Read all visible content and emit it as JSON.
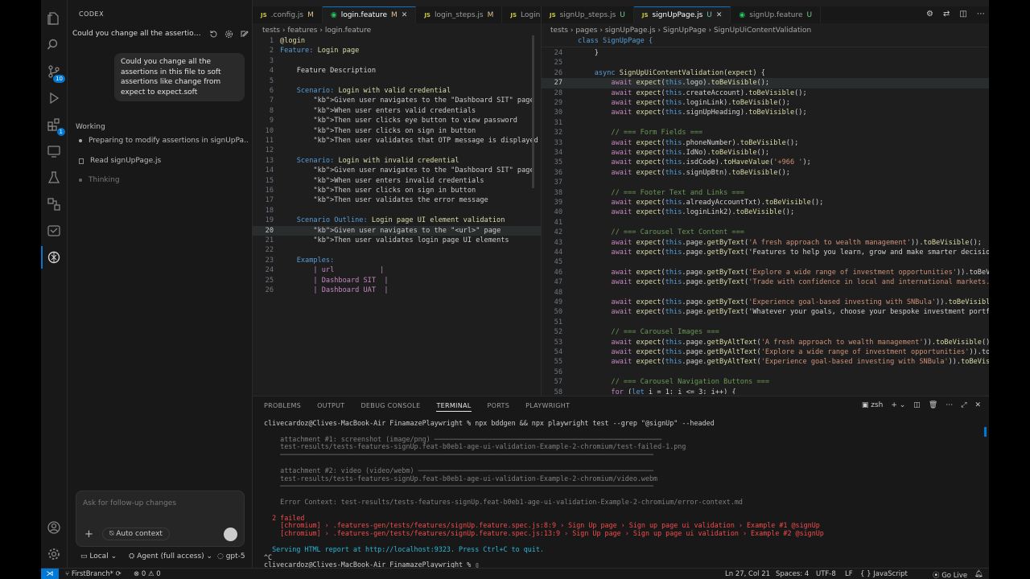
{
  "activity": {
    "scm_badge": "10",
    "test_badge": "1"
  },
  "codex": {
    "title": "CODEX",
    "thread_title": "Could you change all the assertions in t...",
    "user_message": "Could you change all the assertions in this file to soft assertions like change from expect to expect.soft",
    "working_label": "Working",
    "steps": [
      {
        "label": "Preparing to modify assertions in signUpPa..."
      },
      {
        "label": "Read signUpPage.js"
      },
      {
        "label": "Thinking"
      }
    ],
    "input_placeholder": "Ask for follow-up changes",
    "auto_context": "Auto context",
    "footer": {
      "local": "Local",
      "agent": "Agent (full access)",
      "model": "gpt-5"
    }
  },
  "left_tabs": [
    {
      "label": ".config.js",
      "status": "M",
      "icon": "js"
    },
    {
      "label": "login.feature",
      "status": "M",
      "icon": "feature",
      "active": true
    },
    {
      "label": "login_steps.js",
      "status": "M",
      "icon": "js"
    },
    {
      "label": "LoginP",
      "status": "",
      "icon": "js"
    }
  ],
  "right_tabs": [
    {
      "label": "signUp_steps.js",
      "status": "U",
      "icon": "js"
    },
    {
      "label": "signUpPage.js",
      "status": "U",
      "icon": "js",
      "active": true
    },
    {
      "label": "signUp.feature",
      "status": "U",
      "icon": "feature"
    }
  ],
  "left_breadcrumb": [
    "tests",
    "features",
    "login.feature"
  ],
  "right_breadcrumb": [
    "tests",
    "pages",
    "signUpPage.js",
    "SignUpPage",
    "SignUpUiContentValidation"
  ],
  "feature_lines": [
    {
      "n": "1",
      "t": "@login",
      "cls": "y"
    },
    {
      "n": "2",
      "t": "Feature: Login page",
      "cls": "mix1"
    },
    {
      "n": "3",
      "t": ""
    },
    {
      "n": "4",
      "t": "    Feature Description",
      "cls": "p"
    },
    {
      "n": "5",
      "t": ""
    },
    {
      "n": "6",
      "t": "    Scenario: Login with valid credential",
      "cls": "scn"
    },
    {
      "n": "7",
      "t": "        Given user navigates to the \"Dashboard SIT\" page",
      "cls": "step"
    },
    {
      "n": "8",
      "t": "        When user enters valid credentials",
      "cls": "step"
    },
    {
      "n": "9",
      "t": "        Then user clicks eye button to view password",
      "cls": "step"
    },
    {
      "n": "10",
      "t": "        Then user clicks on sign in button",
      "cls": "step"
    },
    {
      "n": "11",
      "t": "        Then user validates that OTP message is displayed",
      "cls": "step"
    },
    {
      "n": "12",
      "t": ""
    },
    {
      "n": "13",
      "t": "    Scenario: Login with invalid credential",
      "cls": "scn"
    },
    {
      "n": "14",
      "t": "        Given user navigates to the \"Dashboard SIT\" page",
      "cls": "step"
    },
    {
      "n": "15",
      "t": "        When user enters invalid credentials",
      "cls": "step"
    },
    {
      "n": "16",
      "t": "        Then user clicks on sign in button",
      "cls": "step"
    },
    {
      "n": "17",
      "t": "        Then user validates the error message",
      "cls": "step"
    },
    {
      "n": "18",
      "t": ""
    },
    {
      "n": "19",
      "t": "    Scenario Outline: Login page UI element validation",
      "cls": "scn"
    },
    {
      "n": "20",
      "t": "        Given user navigates to the \"<url>\" page",
      "cls": "step"
    },
    {
      "n": "21",
      "t": "        Then user validates login page UI elements",
      "cls": "step"
    },
    {
      "n": "22",
      "t": ""
    },
    {
      "n": "23",
      "t": "    Examples:",
      "cls": "kb"
    },
    {
      "n": "24",
      "t": "        | url           |",
      "cls": "g"
    },
    {
      "n": "25",
      "t": "        | Dashboard SIT  |",
      "cls": "g"
    },
    {
      "n": "26",
      "t": "        | Dashboard UAT  |",
      "cls": "g"
    }
  ],
  "sticky_line": "class SignUpPage {",
  "js_lines": [
    {
      "n": "24",
      "t": "    }"
    },
    {
      "n": "25",
      "t": ""
    },
    {
      "n": "26",
      "t": "    async SignUpUiContentValidation(expect) {"
    },
    {
      "n": "27",
      "t": "        await expect(this.logo).toBeVisible();"
    },
    {
      "n": "28",
      "t": "        await expect(this.createAccount).toBeVisible();"
    },
    {
      "n": "29",
      "t": "        await expect(this.loginLink).toBeVisible();"
    },
    {
      "n": "30",
      "t": "        await expect(this.signUpHeading).toBeVisible();"
    },
    {
      "n": "31",
      "t": ""
    },
    {
      "n": "32",
      "t": "        // === Form Fields ==="
    },
    {
      "n": "33",
      "t": "        await expect(this.phoneNumber).toBeVisible();"
    },
    {
      "n": "34",
      "t": "        await expect(this.IdNo).toBeVisible();"
    },
    {
      "n": "35",
      "t": "        await expect(this.isdCode).toHaveValue('+966 ');"
    },
    {
      "n": "36",
      "t": "        await expect(this.signUpBtn).toBeVisible();"
    },
    {
      "n": "37",
      "t": ""
    },
    {
      "n": "38",
      "t": "        // === Footer Text and Links ==="
    },
    {
      "n": "39",
      "t": "        await expect(this.alreadyAccountTxt).toBeVisible();"
    },
    {
      "n": "40",
      "t": "        await expect(this.loginLink2).toBeVisible();"
    },
    {
      "n": "41",
      "t": ""
    },
    {
      "n": "42",
      "t": "        // === Carousel Text Content ==="
    },
    {
      "n": "43",
      "t": "        await expect(this.page.getByText('A fresh approach to wealth management')).toBeVisible();"
    },
    {
      "n": "44",
      "t": "        await expect(this.page.getByText('Features to help you learn, grow and make smarter decisions a"
    },
    {
      "n": "45",
      "t": ""
    },
    {
      "n": "46",
      "t": "        await expect(this.page.getByText('Explore a wide range of investment opportunities')).toBeVisib"
    },
    {
      "n": "47",
      "t": "        await expect(this.page.getByText('Trade with confidence in local and international markets.'))."
    },
    {
      "n": "48",
      "t": ""
    },
    {
      "n": "49",
      "t": "        await expect(this.page.getByText('Experience goal-based investing with SNBula')).toBeVisible();"
    },
    {
      "n": "50",
      "t": "        await expect(this.page.getByText('Whatever your goals, choose your bespoke investment portfolio"
    },
    {
      "n": "51",
      "t": ""
    },
    {
      "n": "52",
      "t": "        // === Carousel Images ==="
    },
    {
      "n": "53",
      "t": "        await expect(this.page.getByAltText('A fresh approach to wealth management')).toBeVisible();"
    },
    {
      "n": "54",
      "t": "        await expect(this.page.getByAltText('Explore a wide range of investment opportunities')).toBeVi"
    },
    {
      "n": "55",
      "t": "        await expect(this.page.getByAltText('Experience goal-based investing with SNBula')).toBeVisible"
    },
    {
      "n": "56",
      "t": ""
    },
    {
      "n": "57",
      "t": "        // === Carousel Navigation Buttons ==="
    },
    {
      "n": "58",
      "t": "        for (let i = 1; i <= 3; i++) {"
    }
  ],
  "panel": {
    "tabs": [
      "PROBLEMS",
      "OUTPUT",
      "DEBUG CONSOLE",
      "TERMINAL",
      "PORTS",
      "PLAYWRIGHT"
    ],
    "shell": "zsh",
    "terminal": [
      {
        "t": "clivecardoz@Clives-MacBook-Air FinamazePlaywright % npx bddgen && npx playwright test --grep \"@signUp\" --headed",
        "cls": ""
      },
      {
        "t": "",
        "cls": ""
      },
      {
        "t": "    attachment #1: screenshot (image/png) ────────────────────────────────────────────────────────",
        "cls": "tdim"
      },
      {
        "t": "    test-results/tests-features-signUp.feat-b0eb1-age-ui-validation-Example-2-chromium/test-failed-1.png",
        "cls": "tdim"
      },
      {
        "t": "    ────────────────────────────────────────────────────────────────────────────────────────────",
        "cls": "tdim"
      },
      {
        "t": "",
        "cls": ""
      },
      {
        "t": "    attachment #2: video (video/webm) ──────────────────────────────────────────────────────────",
        "cls": "tdim"
      },
      {
        "t": "    test-results/tests-features-signUp.feat-b0eb1-age-ui-validation-Example-2-chromium/video.webm",
        "cls": "tdim"
      },
      {
        "t": "    ────────────────────────────────────────────────────────────────────────────────────────────",
        "cls": "tdim"
      },
      {
        "t": "",
        "cls": ""
      },
      {
        "t": "    Error Context: test-results/tests-features-signUp.feat-b0eb1-age-ui-validation-Example-2-chromium/error-context.md",
        "cls": "tdim"
      },
      {
        "t": "",
        "cls": ""
      },
      {
        "t": "  2 failed",
        "cls": "tred"
      },
      {
        "t": "    [chromium] › .features-gen/tests/features/signUp.feature.spec.js:8:9 › Sign Up page › Sign up page ui validation › Example #1 @signUp",
        "cls": "tred"
      },
      {
        "t": "    [chromium] › .features-gen/tests/features/signUp.feature.spec.js:13:9 › Sign Up page › Sign up page ui validation › Example #2 @signUp",
        "cls": "tred"
      },
      {
        "t": "",
        "cls": ""
      },
      {
        "t": "  Serving HTML report at http://localhost:9323. Press Ctrl+C to quit.",
        "cls": "tcyan"
      },
      {
        "t": "^C",
        "cls": ""
      },
      {
        "t": "clivecardoz@Clives-MacBook-Air FinamazePlaywright % ▯",
        "cls": ""
      }
    ]
  },
  "status": {
    "branch": "FirstBranch*",
    "problems": "0",
    "warnings": "0",
    "position": "Ln 27, Col 21",
    "spaces": "Spaces: 4",
    "encoding": "UTF-8",
    "eol": "LF",
    "language": "JavaScript",
    "golive": "Go Live"
  }
}
